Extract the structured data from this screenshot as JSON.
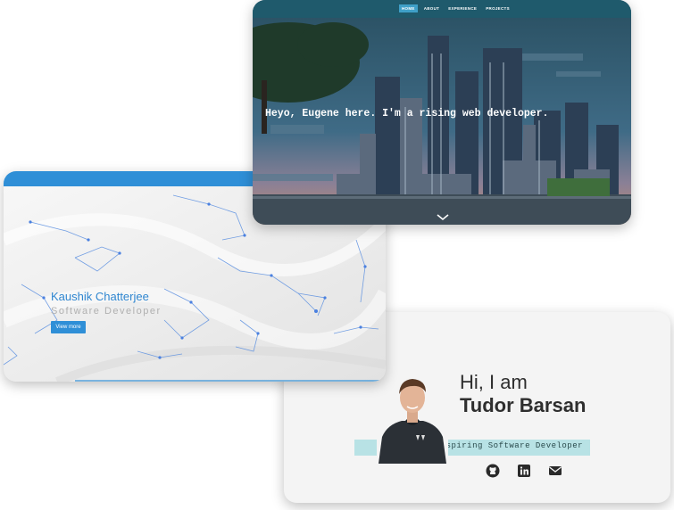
{
  "eugene": {
    "nav": [
      {
        "label": "HOME",
        "active": true
      },
      {
        "label": "ABOUT",
        "active": false
      },
      {
        "label": "EXPERIENCE",
        "active": false
      },
      {
        "label": "PROJECTS",
        "active": false
      }
    ],
    "headline": "Heyo, Eugene here. I'm a rising web developer.",
    "scroll_icon": "chevron-down-icon"
  },
  "kaushik": {
    "name": "Kaushik Chatterjee",
    "role": "Software Developer",
    "button": "View more",
    "accent": "#2f8fd7"
  },
  "tudor": {
    "greeting": "Hi, I am",
    "name": "Tudor Barsan",
    "tagline": "Aspiring Software Developer",
    "band_color": "#b8e2e5",
    "socials": [
      "github-icon",
      "linkedin-icon",
      "email-icon"
    ]
  }
}
